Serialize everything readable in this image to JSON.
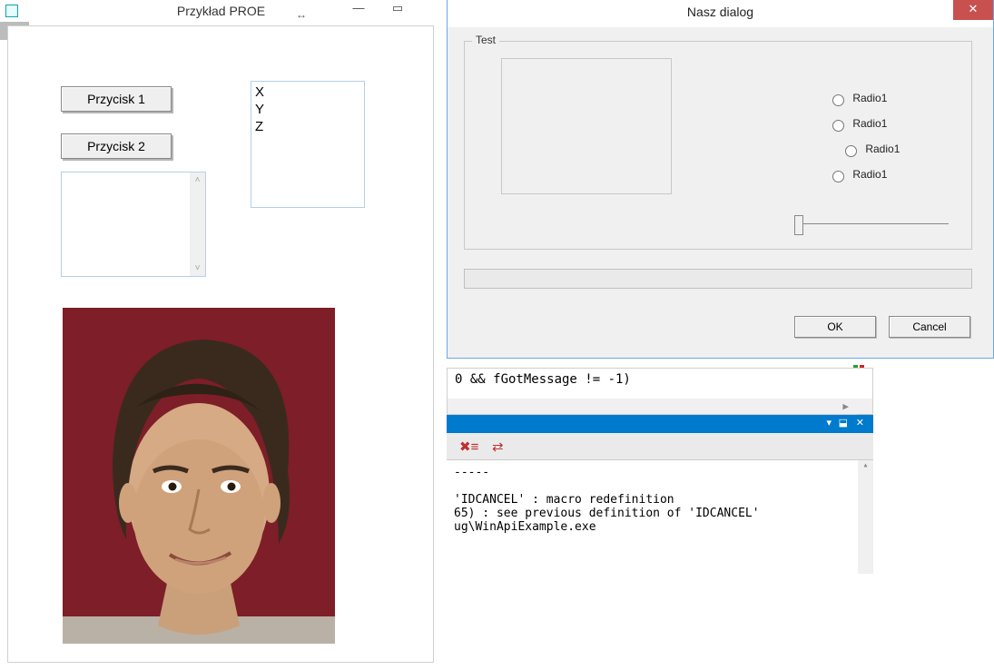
{
  "left_window": {
    "title": "Przykład PROE",
    "button1": "Przycisk 1",
    "button2": "Przycisk 2",
    "list_items": [
      "X",
      "Y",
      "Z"
    ]
  },
  "dialog": {
    "title": "Nasz dialog",
    "group_label": "Test",
    "radio_label": "Radio1",
    "ok_label": "OK",
    "cancel_label": "Cancel"
  },
  "editor": {
    "code_line": "0 && fGotMessage != -1)"
  },
  "output": {
    "line1": "-----",
    "line2": "",
    "line3": "'IDCANCEL' : macro redefinition",
    "line4": "65) : see previous definition of 'IDCANCEL'",
    "line5": "ug\\WinApiExample.exe"
  }
}
